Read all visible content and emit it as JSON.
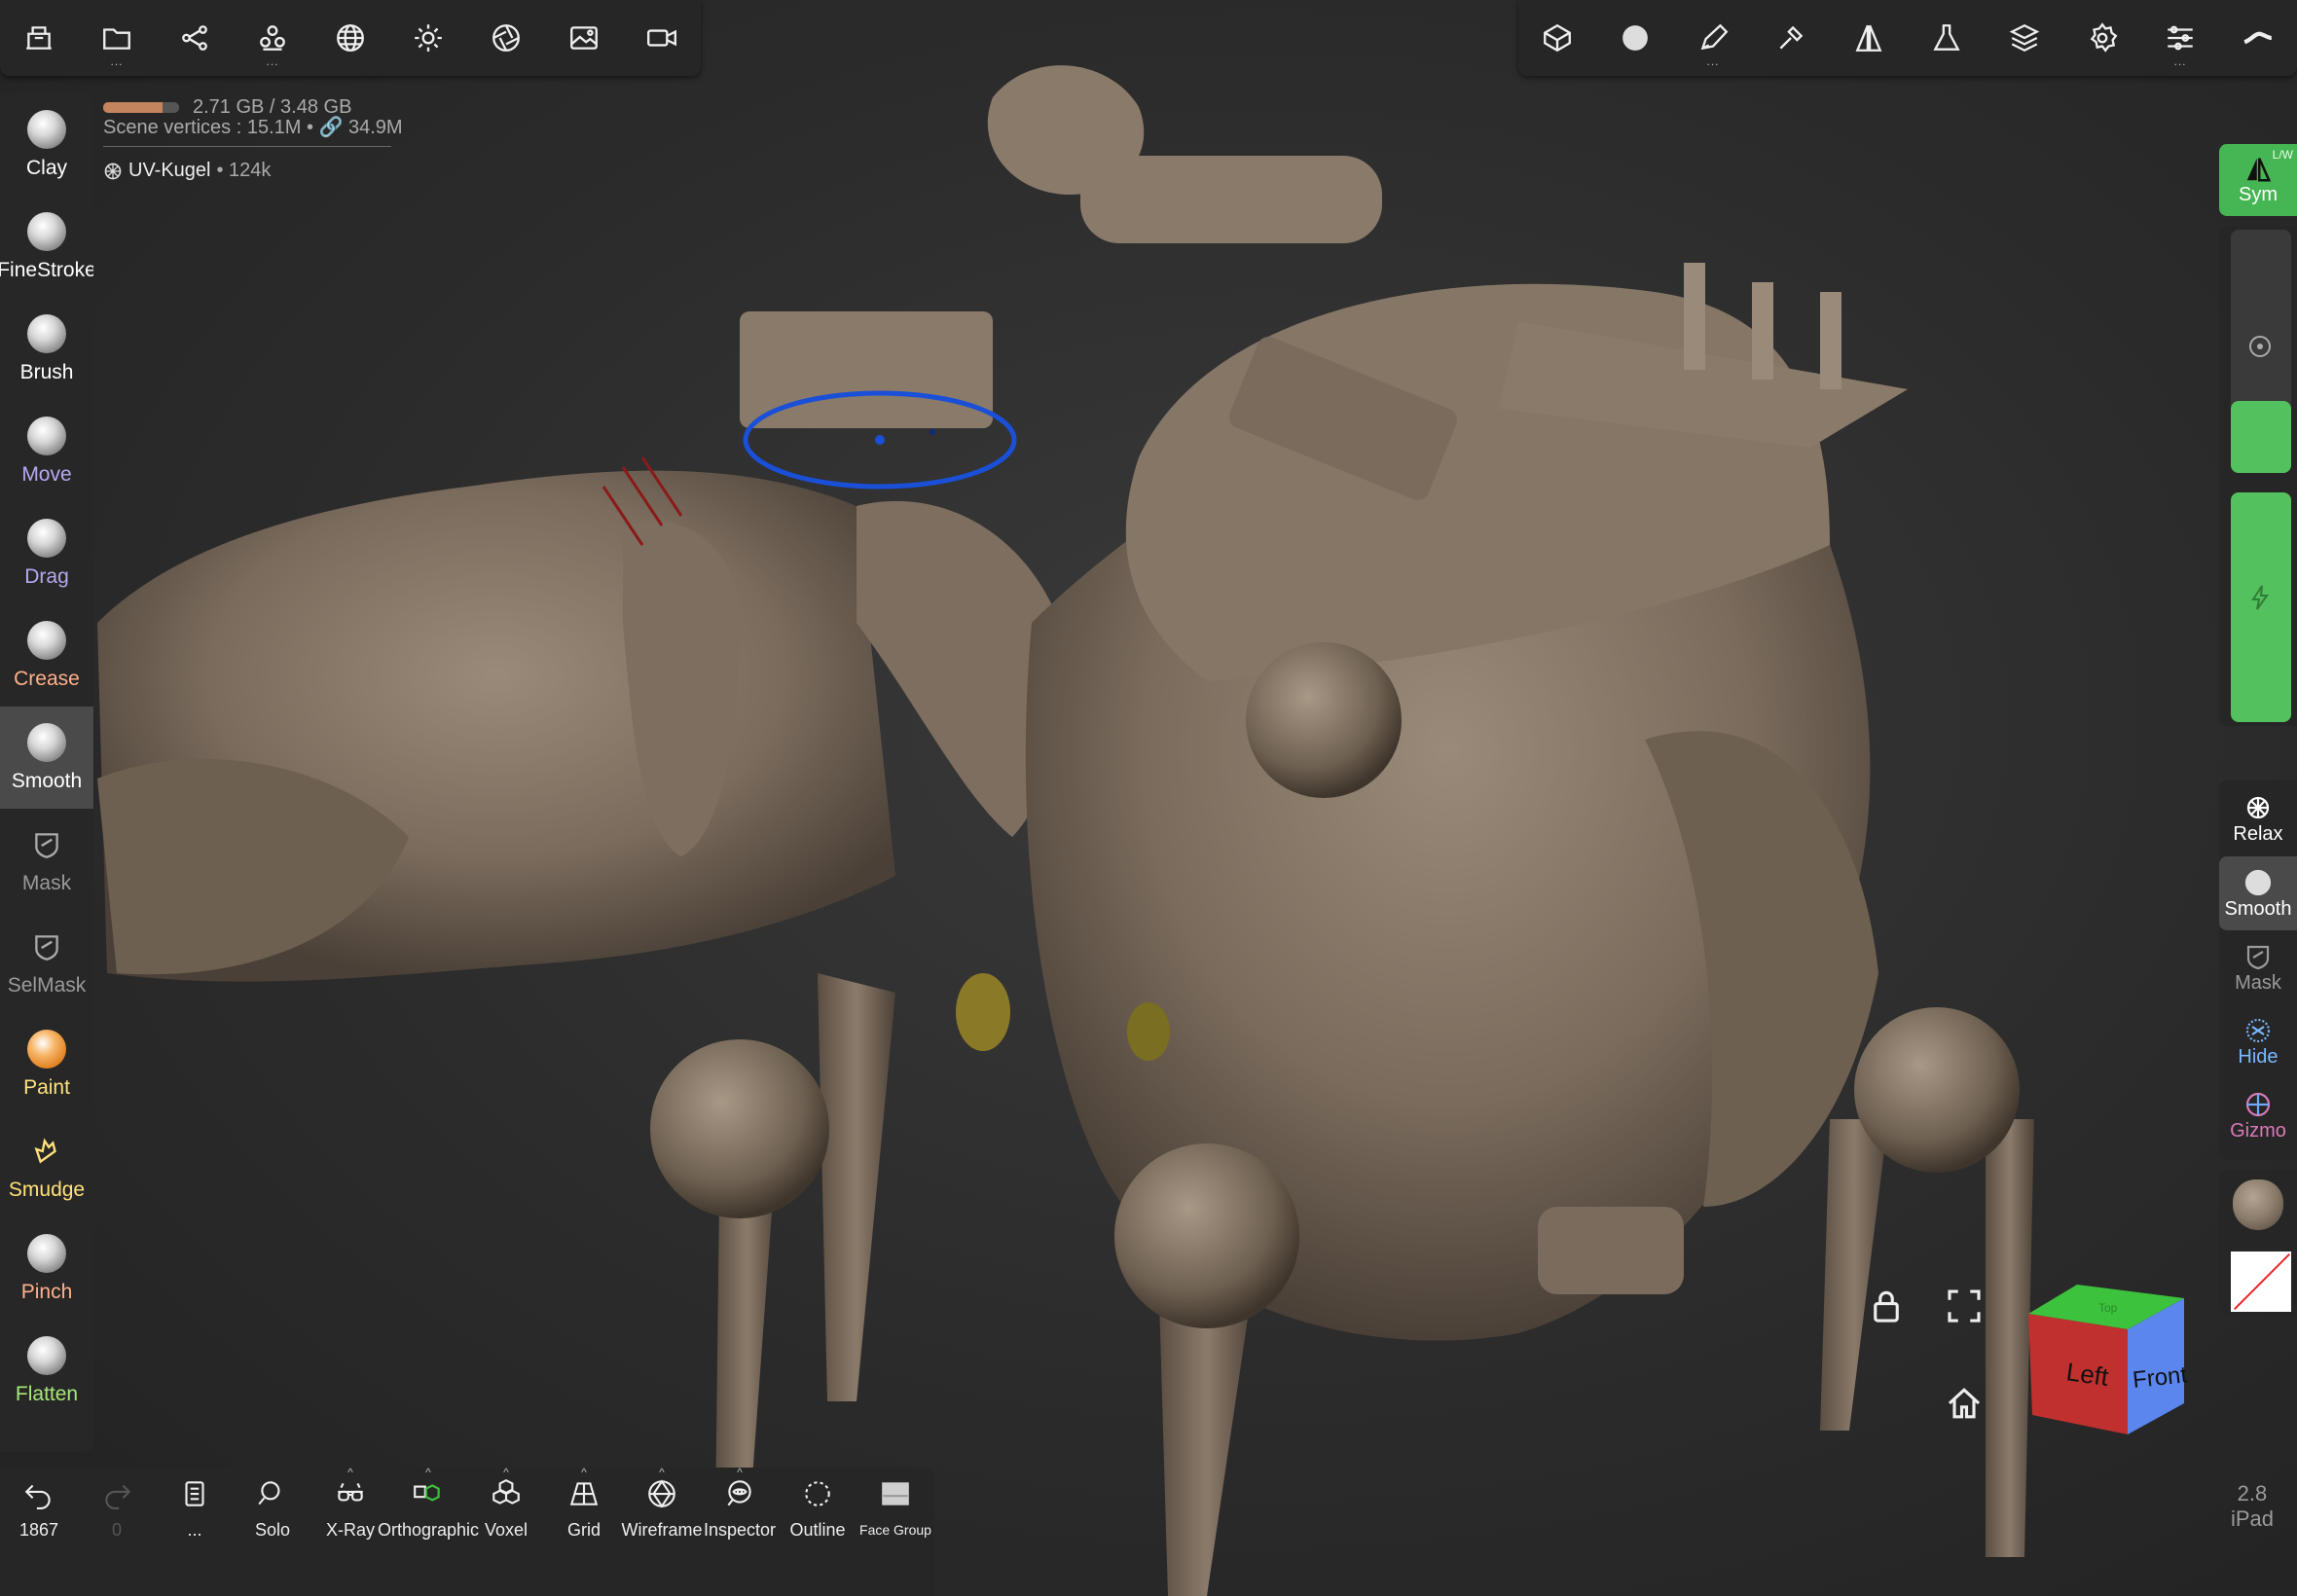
{
  "top_toolbar_left": [
    {
      "name": "scene-icon",
      "dots": false
    },
    {
      "name": "folder-icon",
      "dots": true
    },
    {
      "name": "share-icon",
      "dots": false
    },
    {
      "name": "scene-objects-icon",
      "dots": true
    },
    {
      "name": "mesh-sphere-icon",
      "dots": false
    },
    {
      "name": "sun-icon",
      "dots": false
    },
    {
      "name": "aperture-icon",
      "dots": false
    },
    {
      "name": "image-icon",
      "dots": false
    },
    {
      "name": "video-camera-icon",
      "dots": false
    }
  ],
  "top_toolbar_right": [
    {
      "name": "topology-icon",
      "dots": false
    },
    {
      "name": "smooth-brush-icon",
      "dots": false
    },
    {
      "name": "pen-icon",
      "dots": true
    },
    {
      "name": "stroke-icon",
      "dots": false
    },
    {
      "name": "symmetry-icon",
      "dots": false
    },
    {
      "name": "flask-icon",
      "dots": false
    },
    {
      "name": "layers-icon",
      "dots": false
    },
    {
      "name": "settings-icon",
      "dots": false
    },
    {
      "name": "sliders-icon",
      "dots": true
    },
    {
      "name": "cloud-icon",
      "dots": false
    }
  ],
  "info": {
    "memory_text": "2.71 GB / 3.48 GB",
    "memory_fraction": 0.78,
    "vertices_text": "Scene vertices : 15.1M • 🔗 34.9M",
    "mesh_name": "UV-Kugel",
    "mesh_count": "• 124k"
  },
  "tools": [
    {
      "label": "Clay",
      "color": "#ffffff",
      "kind": "ball"
    },
    {
      "label": "FineStroke",
      "color": "#ffffff",
      "kind": "ball"
    },
    {
      "label": "Brush",
      "color": "#ffffff",
      "kind": "ball"
    },
    {
      "label": "Move",
      "color": "#b7a8f0",
      "kind": "ball"
    },
    {
      "label": "Drag",
      "color": "#b7a8f0",
      "kind": "ball"
    },
    {
      "label": "Crease",
      "color": "#ffb08a",
      "kind": "ball"
    },
    {
      "label": "Smooth",
      "color": "#ffffff",
      "kind": "ball",
      "active": true
    },
    {
      "label": "Mask",
      "color": "#9a9a9a",
      "kind": "mask"
    },
    {
      "label": "SelMask",
      "color": "#9a9a9a",
      "kind": "mask"
    },
    {
      "label": "Paint",
      "color": "#ffe27a",
      "kind": "orange"
    },
    {
      "label": "Smudge",
      "color": "#ffe27a",
      "kind": "smudge"
    },
    {
      "label": "Pinch",
      "color": "#ffb08a",
      "kind": "ball"
    },
    {
      "label": "Flatten",
      "color": "#a7e878",
      "kind": "ball"
    }
  ],
  "right_panel": {
    "sym_label": "Sym",
    "sym_sup": "L/W",
    "radius_level": 0.3,
    "intensity_level": 1.0,
    "buttons": [
      {
        "label": "Relax",
        "color": "#ffffff",
        "icon": "relax-icon"
      },
      {
        "label": "Smooth",
        "color": "#ffffff",
        "icon": "smooth-icon",
        "active": true
      },
      {
        "label": "Mask",
        "color": "#9a9a9a",
        "icon": "mask-icon"
      },
      {
        "label": "Hide",
        "color": "#7ab8ff",
        "icon": "hide-icon"
      },
      {
        "label": "Gizmo",
        "color": "#d97ab8",
        "icon": "gizmo-icon"
      }
    ]
  },
  "bottom_toolbar": [
    {
      "label": "1867",
      "icon": "undo-icon"
    },
    {
      "label": "0",
      "icon": "redo-icon",
      "dim": true
    },
    {
      "label": "...",
      "icon": "history-icon"
    },
    {
      "label": "Solo",
      "icon": "search-icon"
    },
    {
      "label": "X-Ray",
      "icon": "xray-icon",
      "caret": true
    },
    {
      "label": "Orthographic",
      "icon": "orthographic-icon",
      "caret": true
    },
    {
      "label": "Voxel",
      "icon": "voxel-icon",
      "caret": true
    },
    {
      "label": "Grid",
      "icon": "grid-icon",
      "caret": true
    },
    {
      "label": "Wireframe",
      "icon": "wireframe-icon",
      "caret": true
    },
    {
      "label": "Inspector",
      "icon": "inspector-icon",
      "caret": true
    },
    {
      "label": "Outline",
      "icon": "outline-icon"
    },
    {
      "label": "Face Group",
      "icon": "face-group-icon",
      "small": true
    }
  ],
  "view_cube": {
    "left_label": "Left",
    "front_label": "Front",
    "top_label": "Top"
  },
  "version": {
    "number": "2.8",
    "device": "iPad"
  },
  "colors": {
    "accent_green": "#53c15d",
    "panel_bg": "#262626",
    "model": "#8a7a6a",
    "stroke_ring": "#1a4fd8"
  }
}
